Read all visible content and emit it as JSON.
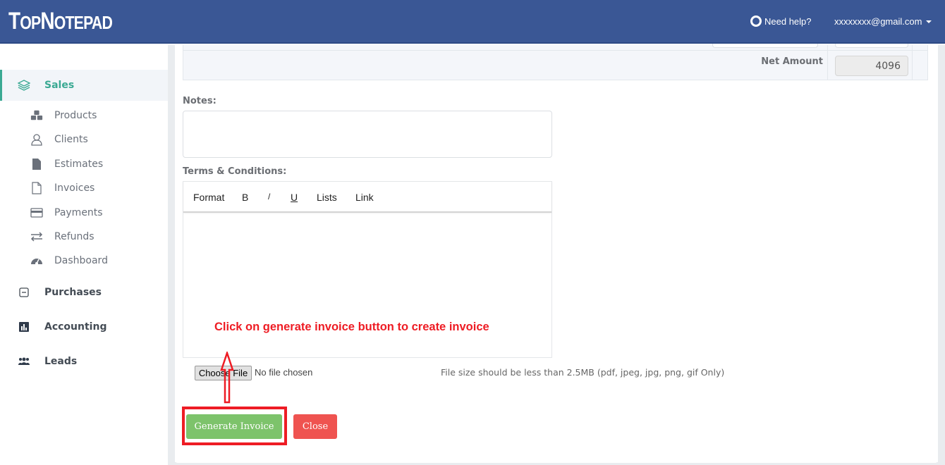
{
  "header": {
    "logo_parts": [
      {
        "text": "T",
        "size": "big"
      },
      {
        "text": "OP",
        "size": "small"
      },
      {
        "text": "N",
        "size": "big"
      },
      {
        "text": "OTEPAD",
        "size": "small"
      }
    ],
    "logo_text": "TopNotepad",
    "help_label": "Need help?",
    "help_icon": "lifebuoy-icon",
    "user_email": "xxxxxxxx@gmail.com"
  },
  "sidebar": {
    "main_items": [
      {
        "label": "Sales",
        "icon": "layers-icon",
        "active": true
      },
      {
        "label": "Purchases",
        "icon": "minus-square-icon",
        "active": false
      },
      {
        "label": "Accounting",
        "icon": "bar-chart-icon",
        "active": false
      },
      {
        "label": "Leads",
        "icon": "users-icon",
        "active": false
      }
    ],
    "sales_sub_items": [
      {
        "label": "Products",
        "icon": "cubes-icon"
      },
      {
        "label": "Clients",
        "icon": "user-outline-icon"
      },
      {
        "label": "Estimates",
        "icon": "file-filled-icon"
      },
      {
        "label": "Invoices",
        "icon": "file-outline-icon"
      },
      {
        "label": "Payments",
        "icon": "credit-card-icon"
      },
      {
        "label": "Refunds",
        "icon": "exchange-icon"
      },
      {
        "label": "Dashboard",
        "icon": "dashboard-icon"
      }
    ]
  },
  "form": {
    "net_amount_label": "Net Amount",
    "net_amount_value": "4096",
    "notes_label": "Notes:",
    "notes_value": "",
    "terms_label": "Terms & Conditions:",
    "editor_toolbar": [
      "Format",
      "B",
      "I",
      "U",
      "Lists",
      "Link"
    ],
    "terms_value": "",
    "file_button_label": "Choose File",
    "file_status": "No file chosen",
    "file_hint": "File size should be less than 2.5MB (pdf, jpeg, jpg, png, gif Only)",
    "generate_button": "Generate Invoice",
    "close_button": "Close"
  },
  "annotation": {
    "text": "Click on generate invoice button to create invoice",
    "color": "#ee1c24"
  },
  "colors": {
    "header_bg": "#3a5795",
    "accent": "#3aa993",
    "generate_btn": "#7dc36b",
    "close_btn": "#ef5350"
  }
}
